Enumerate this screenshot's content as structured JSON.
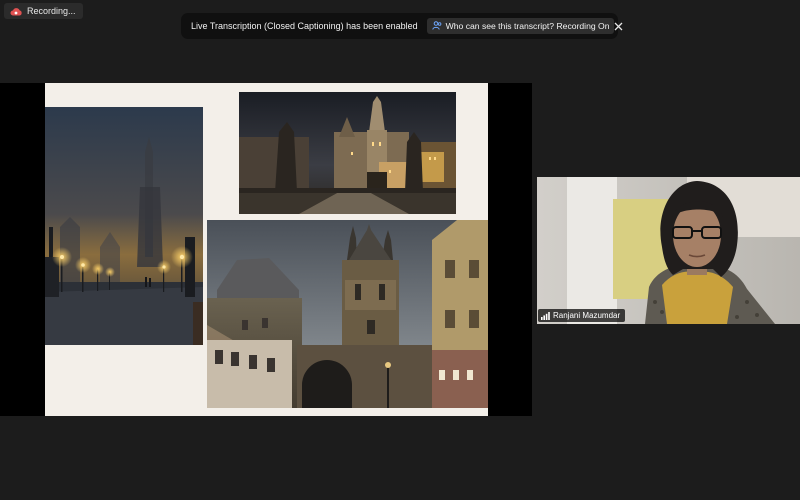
{
  "recording": {
    "label": "Recording...",
    "icon": "cloud-record-icon",
    "color": "#e05252"
  },
  "transcription_banner": {
    "message": "Live Transcription (Closed Captioning) has been enabled",
    "who_button": "Who can see this transcript? Recording On",
    "who_icon": "people-icon",
    "close_icon": "close-icon"
  },
  "shared_screen": {
    "slide": {
      "background": "#f3efe9",
      "photos": [
        "foggy-bridge-night-photo",
        "gothic-tower-night-photo",
        "bridge-tower-dusk-photo"
      ]
    }
  },
  "participant": {
    "name": "Ranjani Mazumdar",
    "signal_icon": "signal-bars-icon"
  }
}
